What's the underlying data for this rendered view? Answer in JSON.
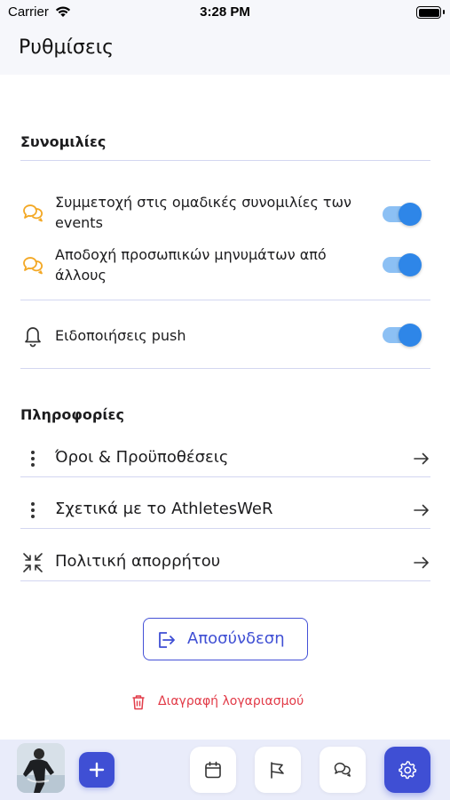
{
  "status_bar": {
    "carrier": "Carrier",
    "time": "3:28 PM"
  },
  "header": {
    "title": "Ρυθμίσεις"
  },
  "chats_section": {
    "title": "Συνομιλίες",
    "toggles": [
      {
        "label": "Συμμετοχή στις ομαδικές συνομιλίες των events",
        "icon": "chat-bubbles-icon",
        "on": true
      },
      {
        "label": "Αποδοχή προσωπικών μηνυμάτων από άλλους",
        "icon": "chat-bubbles-icon",
        "on": true
      }
    ],
    "push": {
      "label": "Ειδοποιήσεις push",
      "icon": "bell-icon",
      "on": true
    }
  },
  "info_section": {
    "title": "Πληροφορίες",
    "links": [
      {
        "label": "Όροι & Προϋποθέσεις",
        "icon": "vertical-dots-icon"
      },
      {
        "label": "Σχετικά με το AthletesWeR",
        "icon": "vertical-dots-icon"
      },
      {
        "label": "Πολιτική απορρήτου",
        "icon": "collapse-arrows-icon"
      }
    ]
  },
  "logout_label": "Αποσύνδεση",
  "delete_account_label": "Διαγραφή λογαριασμού",
  "tab_bar": {
    "items": [
      "profile-avatar",
      "add",
      "calendar",
      "flag",
      "chats",
      "settings"
    ],
    "active": "settings"
  },
  "colors": {
    "accent": "#3f4fd4",
    "toggle_on": "#2e86e8",
    "toggle_track": "#8cc0f4",
    "chat_icon": "#f3a825",
    "danger": "#e23b48",
    "tab_bar_bg": "#e9ecfa"
  }
}
